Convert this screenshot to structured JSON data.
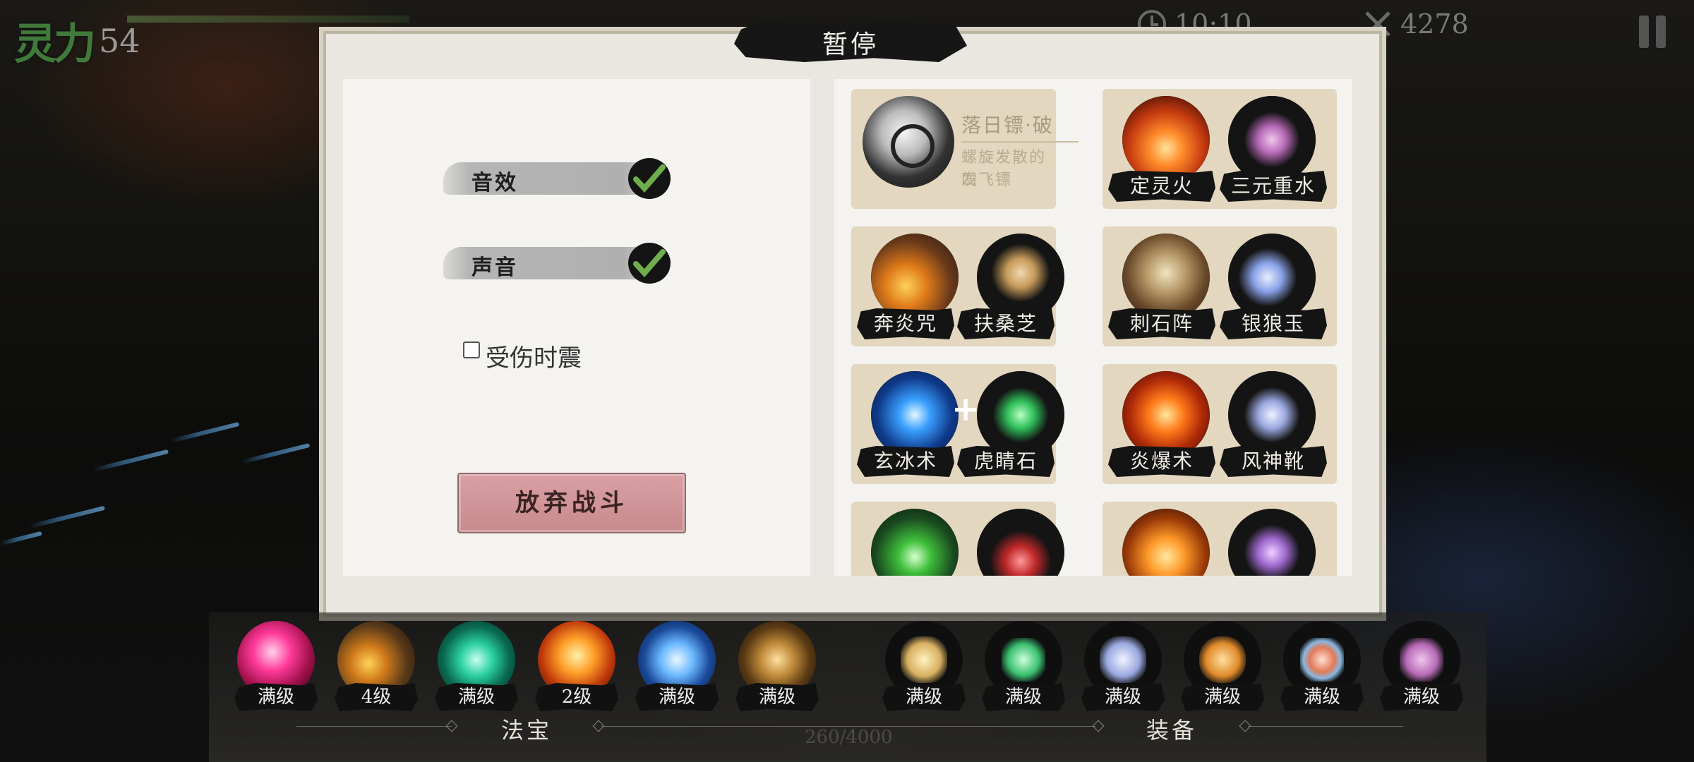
{
  "hud": {
    "power_label": "灵力",
    "power_value": "54",
    "timer": "10:10",
    "kills": "4278"
  },
  "dialog": {
    "title": "暂停",
    "settings": {
      "sound_effect": {
        "label": "音效",
        "checked": true
      },
      "sound": {
        "label": "声音",
        "checked": true
      },
      "shake_on_hit": {
        "label": "受伤时震",
        "checked": false
      },
      "quit_button": "放弃战斗"
    },
    "skills": {
      "featured": {
        "title": "落日镖·破",
        "desc_line1": "螺旋发散的四",
        "desc_line2": "发飞镖"
      },
      "cards": [
        {
          "left": "定灵火",
          "right": "三元重水"
        },
        {
          "left": "奔炎咒",
          "right": "扶桑芝"
        },
        {
          "left": "刺石阵",
          "right": "银狼玉"
        },
        {
          "left": "玄冰术",
          "right": "虎睛石"
        },
        {
          "left": "炎爆术",
          "right": "风神靴"
        }
      ]
    }
  },
  "bottom": {
    "treasure_label": "法宝",
    "equipment_label": "装备",
    "xp": "260/4000",
    "treasure_levels": [
      "满级",
      "4级",
      "满级",
      "2级",
      "满级",
      "满级"
    ],
    "equipment_levels": [
      "满级",
      "满级",
      "满级",
      "满级",
      "满级",
      "满级"
    ]
  },
  "colors": {
    "dialog_bg": "#e9e7df",
    "card_bg": "#e3d7c0",
    "quit_button": "#d4989b",
    "check": "#6fae4a"
  }
}
